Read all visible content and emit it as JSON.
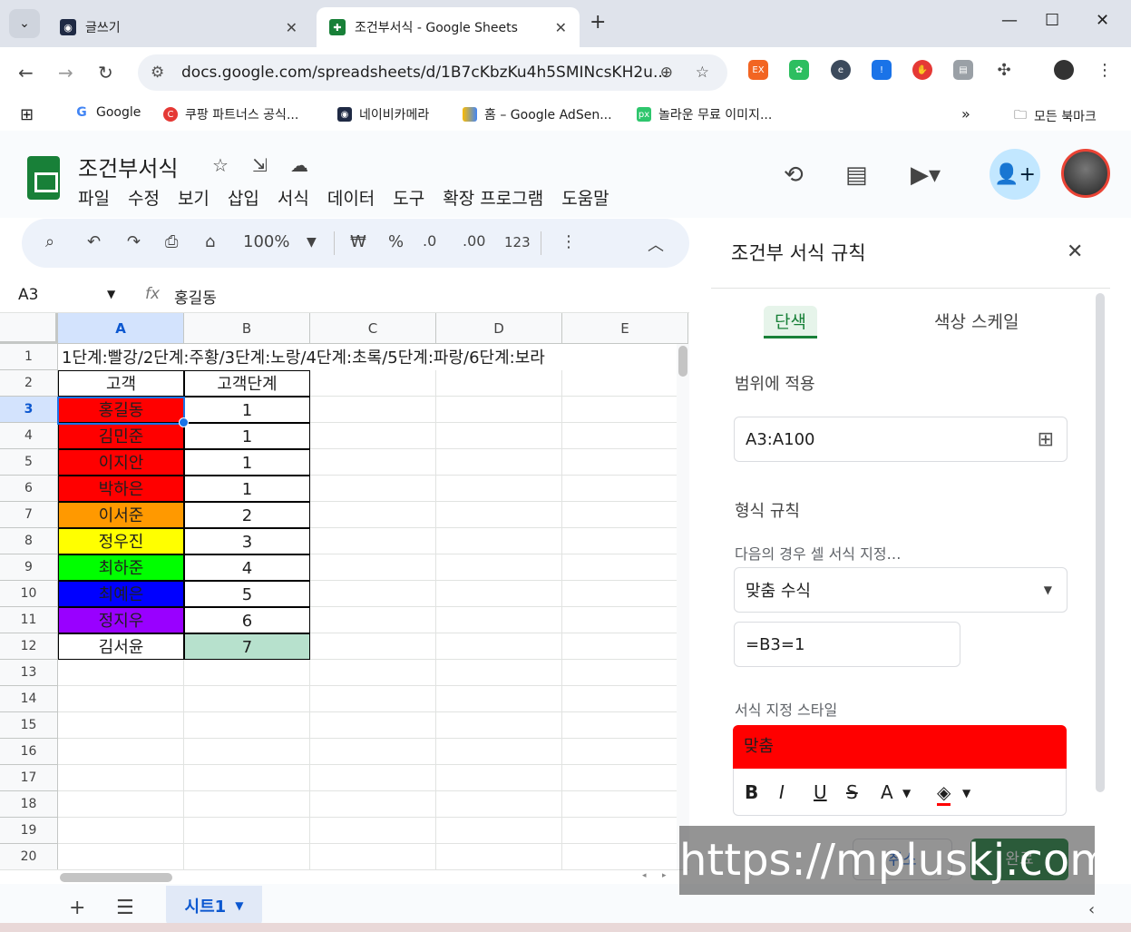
{
  "browser": {
    "tabs": [
      {
        "title": "글쓰기",
        "active": false
      },
      {
        "title": "조건부서식 - Google Sheets",
        "active": true
      }
    ],
    "url": "docs.google.com/spreadsheets/d/1B7cKbzKu4h5SMINcsKH2u...",
    "bookmarks": [
      "Google",
      "쿠팡 파트너스 공식...",
      "네이비카메라",
      "홈 – Google AdSen...",
      "놀라운 무료 이미지..."
    ],
    "all_bookmarks": "모든 북마크",
    "ext_badge": "EX"
  },
  "app": {
    "doc_title": "조건부서식",
    "menus": [
      "파일",
      "수정",
      "보기",
      "삽입",
      "서식",
      "데이터",
      "도구",
      "확장 프로그램",
      "도움말"
    ]
  },
  "toolbar": {
    "zoom": "100%",
    "currency": "₩",
    "percent": "%",
    "dec_minus": ".0",
    "dec_plus": ".00",
    "num_format": "123"
  },
  "formula_bar": {
    "name_box": "A3",
    "fx": "fx",
    "value": "홍길동"
  },
  "grid": {
    "columns": [
      "A",
      "B",
      "C",
      "D",
      "E"
    ],
    "rows": [
      "1",
      "2",
      "3",
      "4",
      "5",
      "6",
      "7",
      "8",
      "9",
      "10",
      "11",
      "12",
      "13",
      "14",
      "15",
      "16",
      "17",
      "18",
      "19",
      "20"
    ],
    "row1_text": "1단계:빨강/2단계:주황/3단계:노랑/4단계:초록/5단계:파랑/6단계:보라",
    "header_a": "고객",
    "header_b": "고객단계",
    "data": [
      {
        "name": "홍길동",
        "level": "1",
        "color": "#ff0000"
      },
      {
        "name": "김민준",
        "level": "1",
        "color": "#ff0000"
      },
      {
        "name": "이지안",
        "level": "1",
        "color": "#ff0000"
      },
      {
        "name": "박하은",
        "level": "1",
        "color": "#ff0000"
      },
      {
        "name": "이서준",
        "level": "2",
        "color": "#ff9900"
      },
      {
        "name": "정우진",
        "level": "3",
        "color": "#ffff00"
      },
      {
        "name": "최하준",
        "level": "4",
        "color": "#00ff00"
      },
      {
        "name": "최예은",
        "level": "5",
        "color": "#0000ff"
      },
      {
        "name": "정지우",
        "level": "6",
        "color": "#9900ff"
      },
      {
        "name": "김서윤",
        "level": "7",
        "color": "#ffffff"
      }
    ],
    "level7_fill": "#b7e1cd"
  },
  "sheet_tab": "시트1",
  "panel": {
    "title": "조건부 서식 규칙",
    "tab_single": "단색",
    "tab_scale": "색상 스케일",
    "apply_label": "범위에 적용",
    "range": "A3:A100",
    "rules_label": "형식 규칙",
    "condition_label": "다음의 경우 셀 서식 지정…",
    "condition": "맞춤 수식",
    "formula": "=B3=1",
    "style_label": "서식 지정 스타일",
    "preview_text": "맞춤",
    "style_bold": "B",
    "style_italic": "I",
    "style_underline": "U",
    "style_strike": "S",
    "style_text_color": "A",
    "cancel": "취소",
    "done": "완료",
    "preview_color": "#ff0000"
  },
  "watermark": "https://mpluskj.com"
}
